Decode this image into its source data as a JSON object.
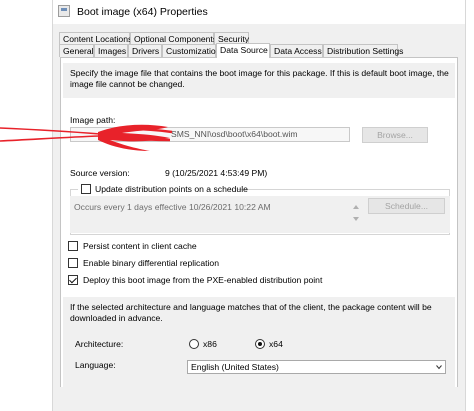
{
  "window": {
    "title": "Boot image (x64) Properties",
    "icon": "package-icon"
  },
  "tabs_row1": [
    {
      "label": "Content Locations"
    },
    {
      "label": "Optional Components"
    },
    {
      "label": "Security"
    }
  ],
  "tabs_row2": [
    {
      "label": "General"
    },
    {
      "label": "Images"
    },
    {
      "label": "Drivers"
    },
    {
      "label": "Customization"
    },
    {
      "label": "Data Source",
      "active": true
    },
    {
      "label": "Data Access"
    },
    {
      "label": "Distribution Settings"
    }
  ],
  "description": "Specify the image file that contains the boot image for this package. If this is default boot image, the image file cannot be changed.",
  "image_path": {
    "label": "Image path:",
    "value": "SMS_NNI\\osd\\boot\\x64\\boot.wim",
    "browse_label": "Browse..."
  },
  "source_version": {
    "label": "Source version:",
    "value": "9 (10/25/2021 4:53:49 PM)"
  },
  "schedule": {
    "checkbox_label": "Update distribution points on a schedule",
    "checked": false,
    "text": "Occurs every 1 days effective 10/26/2021 10:22 AM",
    "button_label": "Schedule..."
  },
  "options": [
    {
      "label": "Persist content in client cache",
      "checked": false
    },
    {
      "label": "Enable binary differential replication",
      "checked": false
    },
    {
      "label": "Deploy this boot image from the PXE-enabled distribution point",
      "checked": true
    }
  ],
  "architecture_section": {
    "note": "If the selected architecture and language matches that of the client, the package content will be downloaded in advance.",
    "architecture_label": "Architecture:",
    "arch_options": [
      {
        "label": "x86",
        "selected": false
      },
      {
        "label": "x64",
        "selected": true
      }
    ],
    "language_label": "Language:",
    "language_value": "English (United States)"
  },
  "colors": {
    "window_bg": "#f0f0f0",
    "panel_bg": "#ffffff",
    "annotation_red": "#e8222a"
  }
}
